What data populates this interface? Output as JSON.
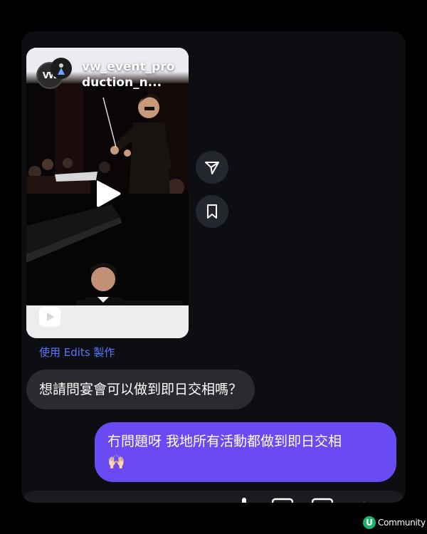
{
  "reel": {
    "username": "vw_event_production_n...",
    "avatar_text": "VW",
    "play_icon": "play-icon",
    "reel_icon": "reels-play-icon"
  },
  "actions": {
    "share_icon": "share-paper-plane-icon",
    "save_icon": "bookmark-icon"
  },
  "edits_link": "使用 Edits 製作",
  "messages": [
    {
      "sender": "incoming",
      "text": "想請問宴會可以做到即日交相嗎？"
    },
    {
      "sender": "outgoing",
      "text": "冇問題呀 我地所有活動都做到即日交相",
      "emoji": "🙌🏻"
    }
  ],
  "watermark": {
    "logo": "U",
    "text": "Community"
  },
  "colors": {
    "background": "#000000",
    "panel": "#0c0e12",
    "incoming_bubble": "#2a2b30",
    "outgoing_bubble": "#6a4bf3",
    "link": "#5c76ff",
    "watermark_logo": "#19b36b"
  }
}
